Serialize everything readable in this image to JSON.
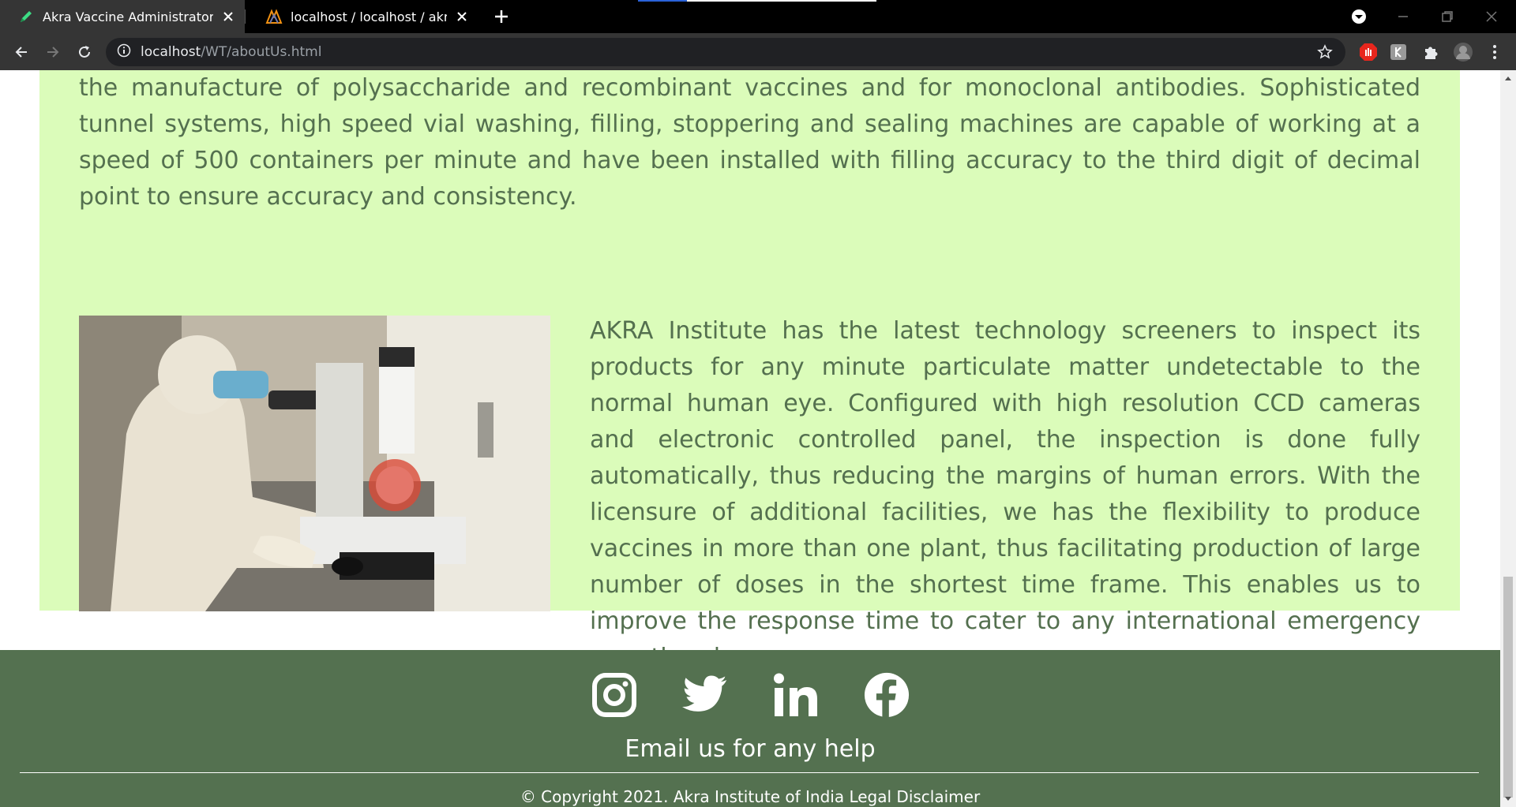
{
  "browser": {
    "tabs": [
      {
        "title": "Akra Vaccine Administrator - Abo",
        "icon": "pen-icon",
        "active": true
      },
      {
        "title": "localhost / localhost / akra / aefi",
        "icon": "phpmyadmin-icon",
        "active": false
      }
    ],
    "url_host": "localhost",
    "url_path": "/WT/aboutUs.html"
  },
  "content": {
    "paragraph_top": "the manufacture of polysaccharide and recombinant vaccines and for monoclonal antibodies. Sophisticated tunnel systems, high speed vial washing, filling, stoppering and sealing machines are capable of working at a speed of 500 containers per minute and have been installed with filling accuracy to the third digit of decimal point to ensure accuracy and consistency.",
    "paragraph_right": "AKRA Institute has the latest technology screeners to inspect its products for any minute particulate matter undetectable to the normal human eye. Configured with high resolution CCD cameras and electronic controlled panel, the inspection is done fully automatically, thus reducing the margins of human errors. With the licensure of additional facilities, we has the flexibility to produce vaccines in more than one plant, thus facilitating production of large number of doses in the shortest time frame. This enables us to improve the response time to cater to any international emergency or outbreak.",
    "colors": {
      "panel_bg": "#dbfcba",
      "text": "#54704f"
    }
  },
  "footer": {
    "social_icons": [
      "instagram-icon",
      "twitter-icon",
      "linkedin-icon",
      "facebook-icon"
    ],
    "help_text": "Email us for any help",
    "copyright": "© Copyright 2021. Akra Institute of India Legal Disclaimer",
    "colors": {
      "bg": "#547150",
      "text": "#ffffff"
    }
  }
}
